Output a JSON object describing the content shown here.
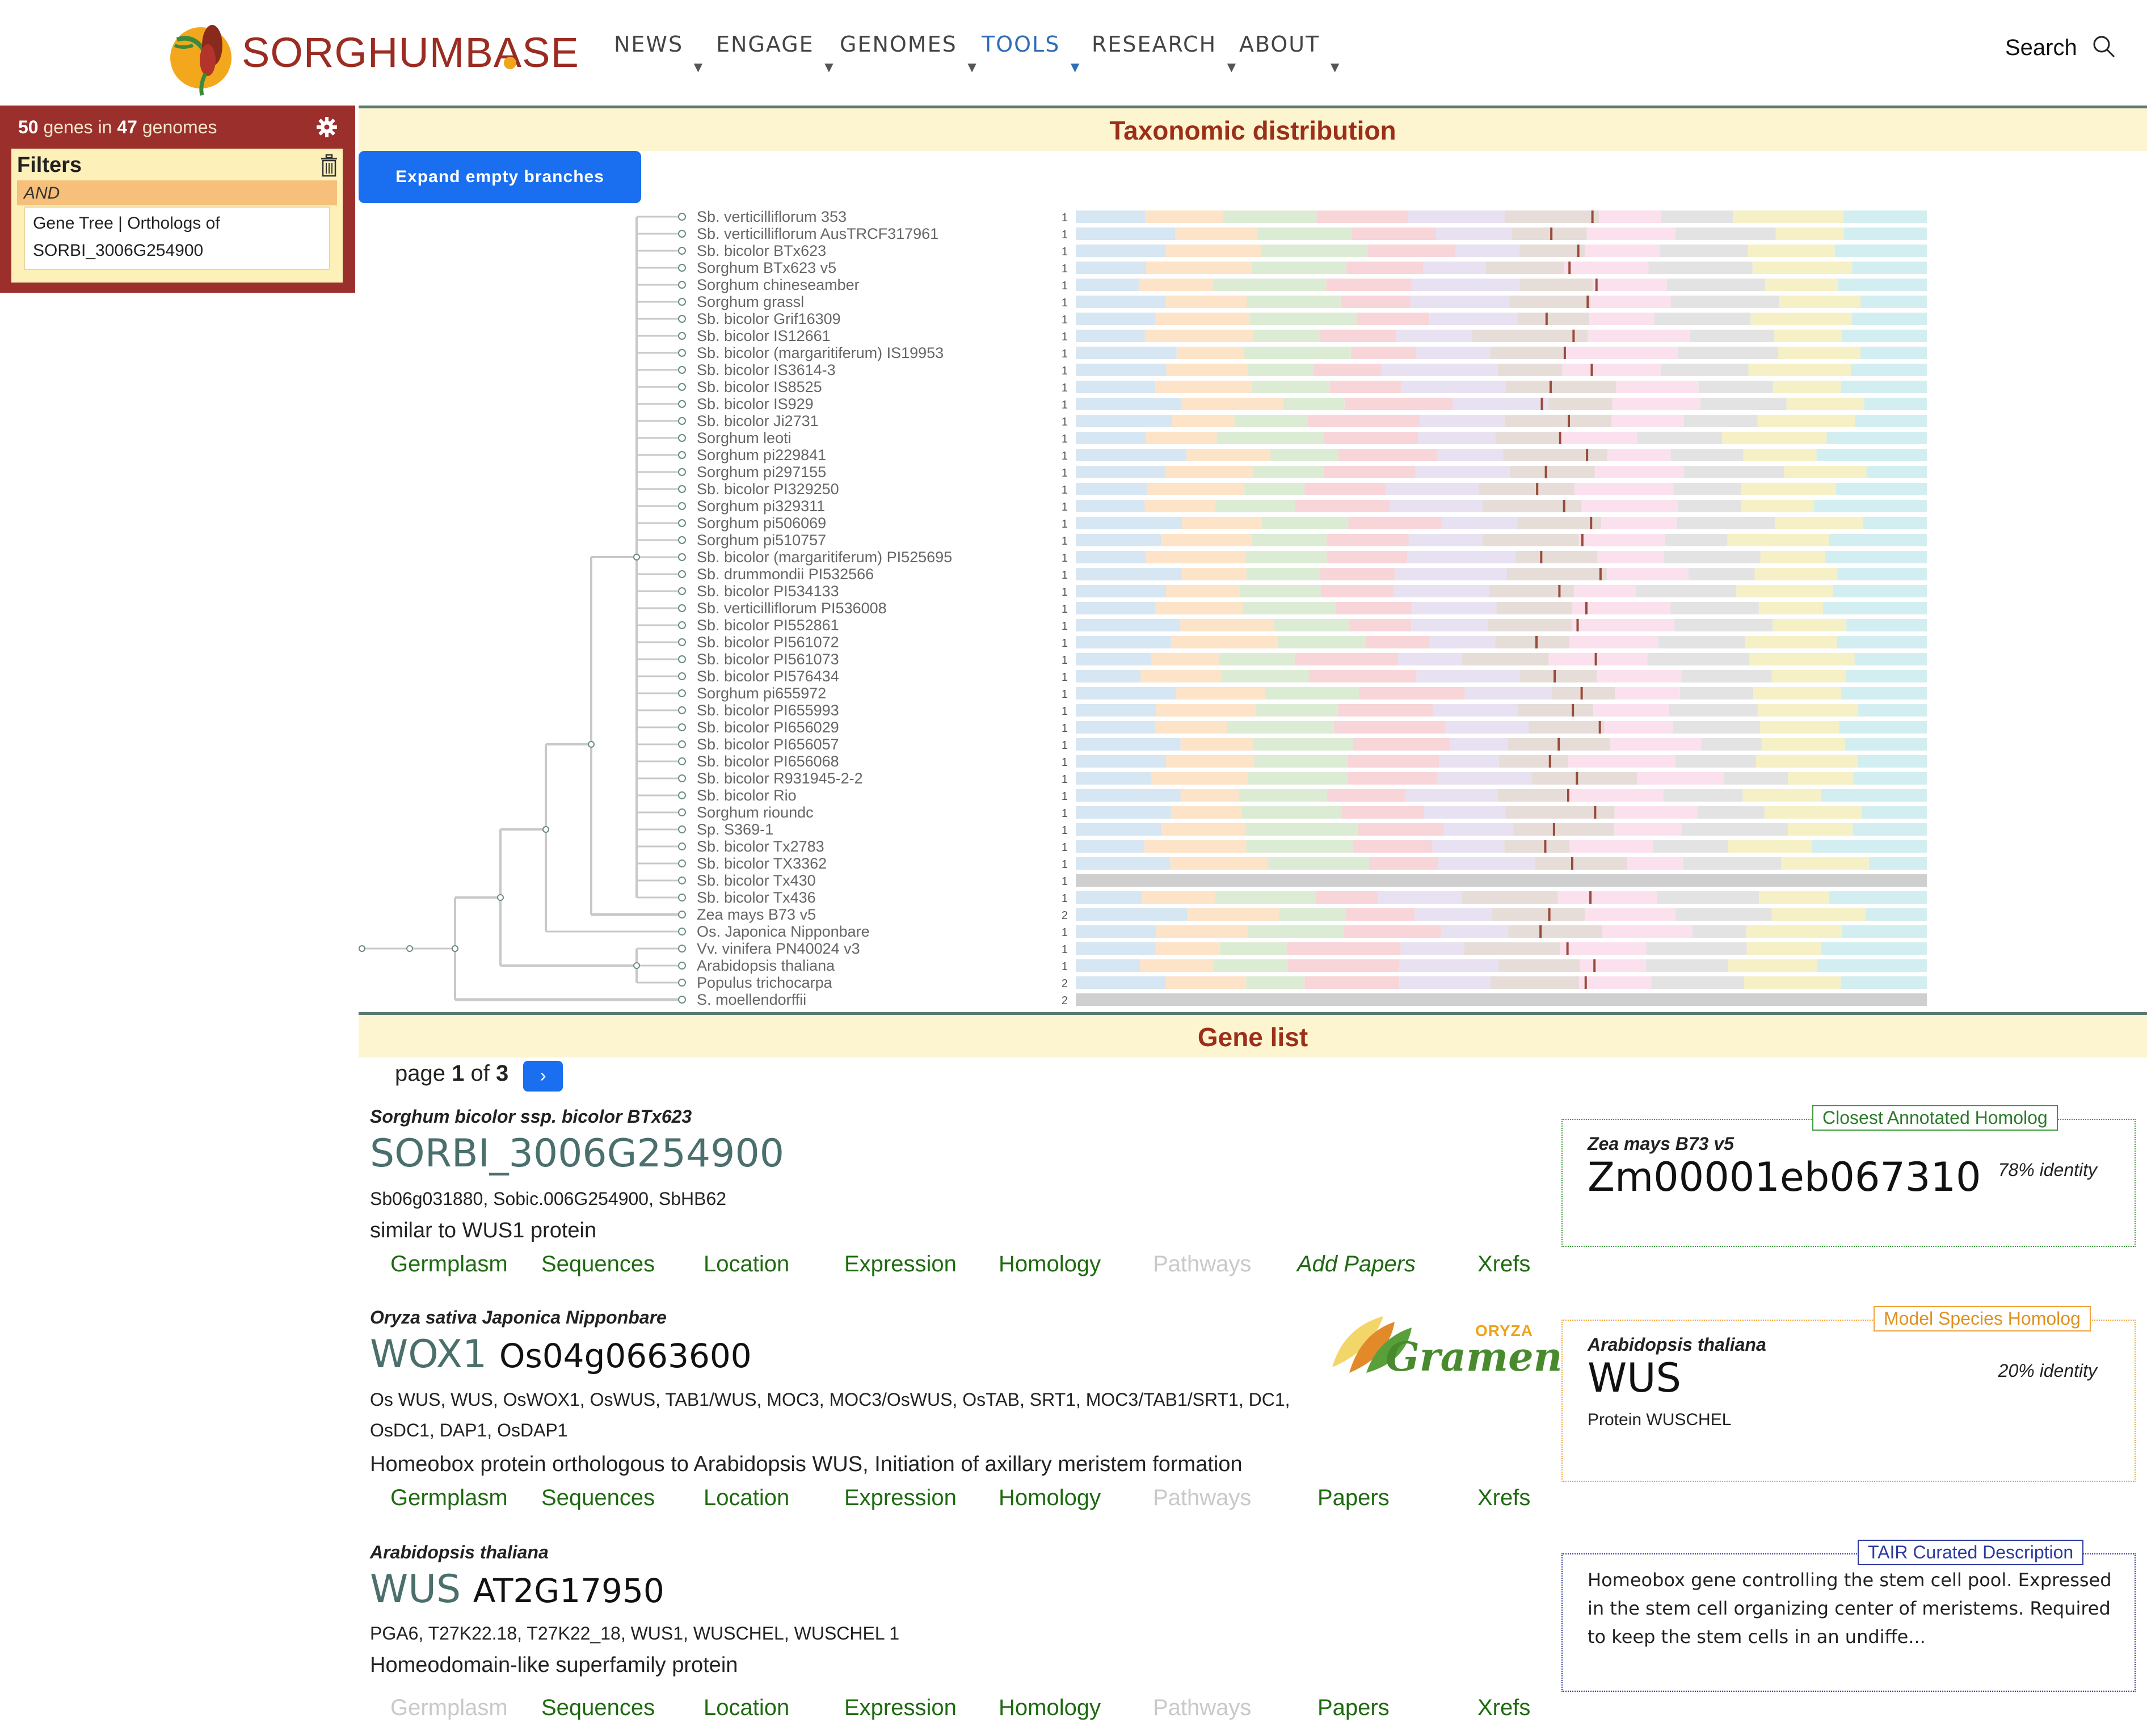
{
  "header": {
    "logo_text": "SORGHUMBASE",
    "nav": [
      {
        "label": "NEWS",
        "active": false
      },
      {
        "label": "ENGAGE",
        "active": false
      },
      {
        "label": "GENOMES",
        "active": false
      },
      {
        "label": "TOOLS",
        "active": true
      },
      {
        "label": "RESEARCH",
        "active": false
      },
      {
        "label": "ABOUT",
        "active": false
      }
    ],
    "search_label": "Search"
  },
  "filter_panel": {
    "gene_count": "50",
    "genes_in": "genes in",
    "genome_count": "47",
    "genomes": "genomes",
    "filters_title": "Filters",
    "operator": "AND",
    "filter_line1": "Gene Tree | Orthologs of",
    "filter_line2": "SORBI_3006G254900"
  },
  "taxonomy": {
    "title": "Taxonomic distribution",
    "expand_button": "Expand empty branches",
    "genomes": [
      {
        "name": "Sb. verticilliflorum 353",
        "count": "1"
      },
      {
        "name": "Sb. verticilliflorum AusTRCF317961",
        "count": "1"
      },
      {
        "name": "Sb. bicolor BTx623",
        "count": "1"
      },
      {
        "name": "Sorghum BTx623 v5",
        "count": "1"
      },
      {
        "name": "Sorghum chineseamber",
        "count": "1"
      },
      {
        "name": "Sorghum grassl",
        "count": "1"
      },
      {
        "name": "Sb. bicolor Grif16309",
        "count": "1"
      },
      {
        "name": "Sb. bicolor IS12661",
        "count": "1"
      },
      {
        "name": "Sb. bicolor (margaritiferum) IS19953",
        "count": "1"
      },
      {
        "name": "Sb. bicolor IS3614-3",
        "count": "1"
      },
      {
        "name": "Sb. bicolor IS8525",
        "count": "1"
      },
      {
        "name": "Sb. bicolor IS929",
        "count": "1"
      },
      {
        "name": "Sb. bicolor Ji2731",
        "count": "1"
      },
      {
        "name": "Sorghum leoti",
        "count": "1"
      },
      {
        "name": "Sorghum pi229841",
        "count": "1"
      },
      {
        "name": "Sorghum pi297155",
        "count": "1"
      },
      {
        "name": "Sb. bicolor PI329250",
        "count": "1"
      },
      {
        "name": "Sorghum pi329311",
        "count": "1"
      },
      {
        "name": "Sorghum pi506069",
        "count": "1"
      },
      {
        "name": "Sorghum pi510757",
        "count": "1"
      },
      {
        "name": "Sb. bicolor (margaritiferum) PI525695",
        "count": "1"
      },
      {
        "name": "Sb. drummondii PI532566",
        "count": "1"
      },
      {
        "name": "Sb. bicolor PI534133",
        "count": "1"
      },
      {
        "name": "Sb. verticilliflorum PI536008",
        "count": "1"
      },
      {
        "name": "Sb. bicolor PI552861",
        "count": "1"
      },
      {
        "name": "Sb. bicolor PI561072",
        "count": "1"
      },
      {
        "name": "Sb. bicolor PI561073",
        "count": "1"
      },
      {
        "name": "Sb. bicolor PI576434",
        "count": "1"
      },
      {
        "name": "Sorghum pi655972",
        "count": "1"
      },
      {
        "name": "Sb. bicolor PI655993",
        "count": "1"
      },
      {
        "name": "Sb. bicolor PI656029",
        "count": "1"
      },
      {
        "name": "Sb. bicolor PI656057",
        "count": "1"
      },
      {
        "name": "Sb. bicolor PI656068",
        "count": "1"
      },
      {
        "name": "Sb. bicolor R931945-2-2",
        "count": "1"
      },
      {
        "name": "Sb. bicolor Rio",
        "count": "1"
      },
      {
        "name": "Sorghum rioundc",
        "count": "1"
      },
      {
        "name": "Sp. S369-1",
        "count": "1"
      },
      {
        "name": "Sb. bicolor Tx2783",
        "count": "1"
      },
      {
        "name": "Sb. bicolor TX3362",
        "count": "1"
      },
      {
        "name": "Sb. bicolor Tx430",
        "count": "1"
      },
      {
        "name": "Sb. bicolor Tx436",
        "count": "1"
      },
      {
        "name": "Zea mays B73 v5",
        "count": "2"
      },
      {
        "name": "Os. Japonica Nipponbare",
        "count": "1"
      },
      {
        "name": "Vv. vinifera PN40024 v3",
        "count": "1"
      },
      {
        "name": "Arabidopsis thaliana",
        "count": "1"
      },
      {
        "name": "Populus trichocarpa",
        "count": "2"
      },
      {
        "name": "S. moellendorffii",
        "count": "2"
      }
    ],
    "chrom_colors": [
      "#d6e6f2",
      "#fde3c8",
      "#dcecd4",
      "#f8d5d8",
      "#e7e1f1",
      "#e6ddd8",
      "#fbe1ee",
      "#e3e3e3",
      "#f6f0c6",
      "#d3eef0"
    ],
    "marker_color": "#9a4a3a"
  },
  "gene_list": {
    "title": "Gene list",
    "page_label": "page",
    "page_current": "1",
    "page_of": "of",
    "page_total": "3",
    "next_label": "›",
    "genes": [
      {
        "species": "Sorghum bicolor ssp. bicolor BTx623",
        "name": "SORBI_3006G254900",
        "id": "",
        "synonyms": "Sb06g031880, Sobic.006G254900, SbHB62",
        "description": "similar to WUS1 protein",
        "links": [
          "Germplasm",
          "Sequences",
          "Location",
          "Expression",
          "Homology",
          "Pathways",
          "Add Papers",
          "Xrefs"
        ]
      },
      {
        "species": "Oryza sativa Japonica Nipponbare",
        "name": "WOX1",
        "id": "Os04g0663600",
        "synonyms": "Os WUS, WUS, OsWOX1, OsWUS, TAB1/WUS, MOC3, MOC3/OsWUS, OsTAB, SRT1, MOC3/TAB1/SRT1, DC1, OsDC1, DAP1, OsDAP1",
        "description": "Homeobox protein orthologous to Arabidopsis WUS, Initiation of axillary meristem formation",
        "links": [
          "Germplasm",
          "Sequences",
          "Location",
          "Expression",
          "Homology",
          "Pathways",
          "Papers",
          "Xrefs"
        ],
        "gramene_oryza": "ORYZA",
        "gramene_text": "Gramene"
      },
      {
        "species": "Arabidopsis thaliana",
        "name": "WUS",
        "id": "AT2G17950",
        "synonyms": "PGA6, T27K22.18, T27K22_18, WUS1, WUSCHEL, WUSCHEL 1",
        "description": "Homeodomain-like superfamily protein",
        "links": [
          "Germplasm",
          "Sequences",
          "Location",
          "Expression",
          "Homology",
          "Pathways",
          "Papers",
          "Xrefs"
        ]
      }
    ],
    "homolog_boxes": [
      {
        "label": "Closest Annotated Homolog",
        "species": "Zea mays B73 v5",
        "name": "Zm00001eb067310",
        "identity": "78% identity",
        "description": "",
        "color": "#3c9a3c"
      },
      {
        "label": "Model Species Homolog",
        "species": "Arabidopsis thaliana",
        "name": "WUS",
        "identity": "20% identity",
        "description": "Protein WUSCHEL",
        "color": "#f0a23a"
      },
      {
        "label": "TAIR Curated Description",
        "text": "Homeobox gene controlling the stem cell pool. Expressed in the stem cell organizing center of meristems. Required to keep the stem cells in an undiffe...",
        "color": "#2c3aa0"
      }
    ]
  }
}
